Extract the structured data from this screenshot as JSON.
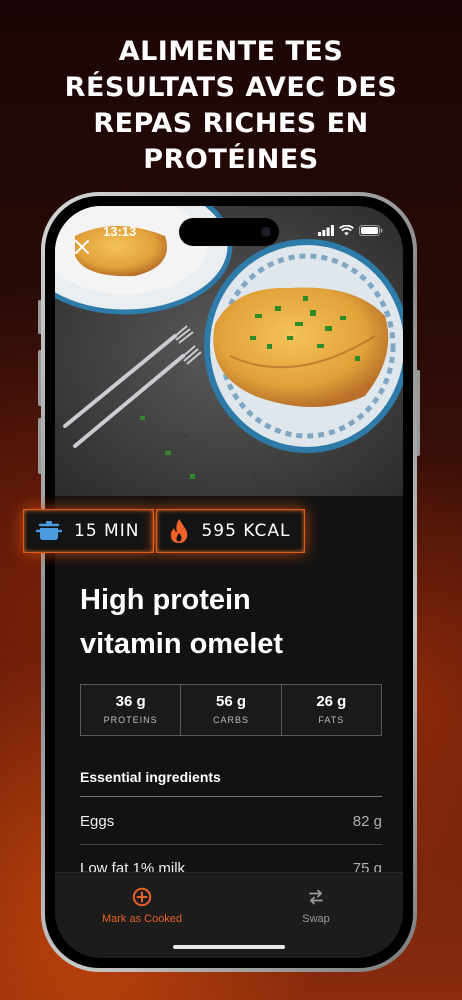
{
  "headline": {
    "lines": [
      "ALIMENTE TES",
      "RÉSULTATS AVEC DES",
      "REPAS RICHES EN",
      "PROTÉINES"
    ]
  },
  "status_bar": {
    "time": "13:13"
  },
  "badges": {
    "time": {
      "label": "15 MIN",
      "icon": "pot-icon"
    },
    "calories": {
      "label": "595 KCAL",
      "icon": "flame-icon"
    }
  },
  "recipe": {
    "title_line1": "High protein",
    "title_line2": "vitamin omelet"
  },
  "macros": [
    {
      "value": "36 g",
      "label": "PROTEINS"
    },
    {
      "value": "56 g",
      "label": "CARBS"
    },
    {
      "value": "26 g",
      "label": "FATS"
    }
  ],
  "ingredients": {
    "heading": "Essential ingredients",
    "items": [
      {
        "name": "Eggs",
        "quantity": "82 g"
      },
      {
        "name": "Low fat 1% milk",
        "quantity": "75 g"
      }
    ]
  },
  "tabbar": {
    "mark_cooked": "Mark as Cooked",
    "swap": "Swap"
  },
  "colors": {
    "accent": "#e8622a",
    "badge_border": "#e05a18",
    "background_dark": "#121212"
  }
}
